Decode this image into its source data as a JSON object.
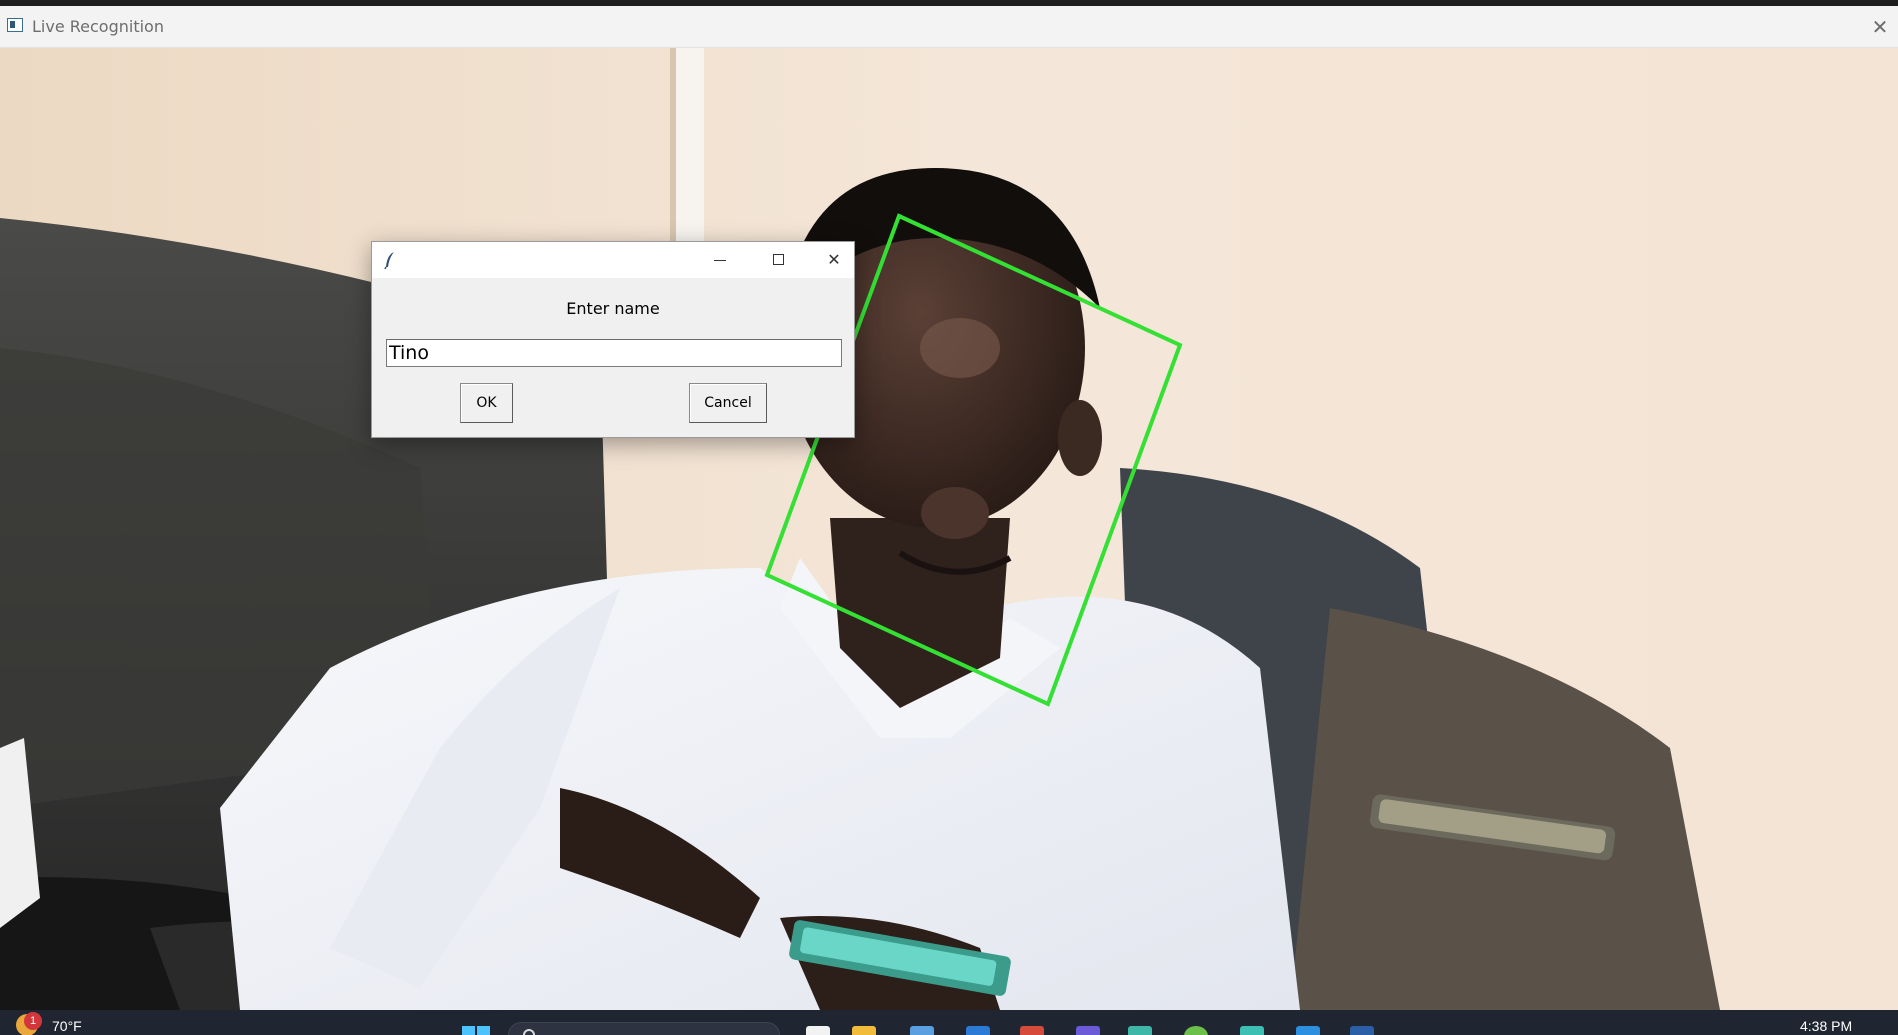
{
  "main_window": {
    "title": "Live Recognition",
    "close_symbol": "✕"
  },
  "camera": {
    "face_box_color": "#33e033"
  },
  "dialog": {
    "prompt": "Enter name",
    "input_value": "Tino",
    "ok_label": "OK",
    "cancel_label": "Cancel",
    "close_symbol": "✕"
  },
  "taskbar": {
    "weather_badge": "1",
    "temperature": "70°F",
    "clock": "4:38 PM"
  },
  "colors": {
    "accent_blue": "#4cc2ff",
    "taskbar_bg": "#1f2531"
  }
}
